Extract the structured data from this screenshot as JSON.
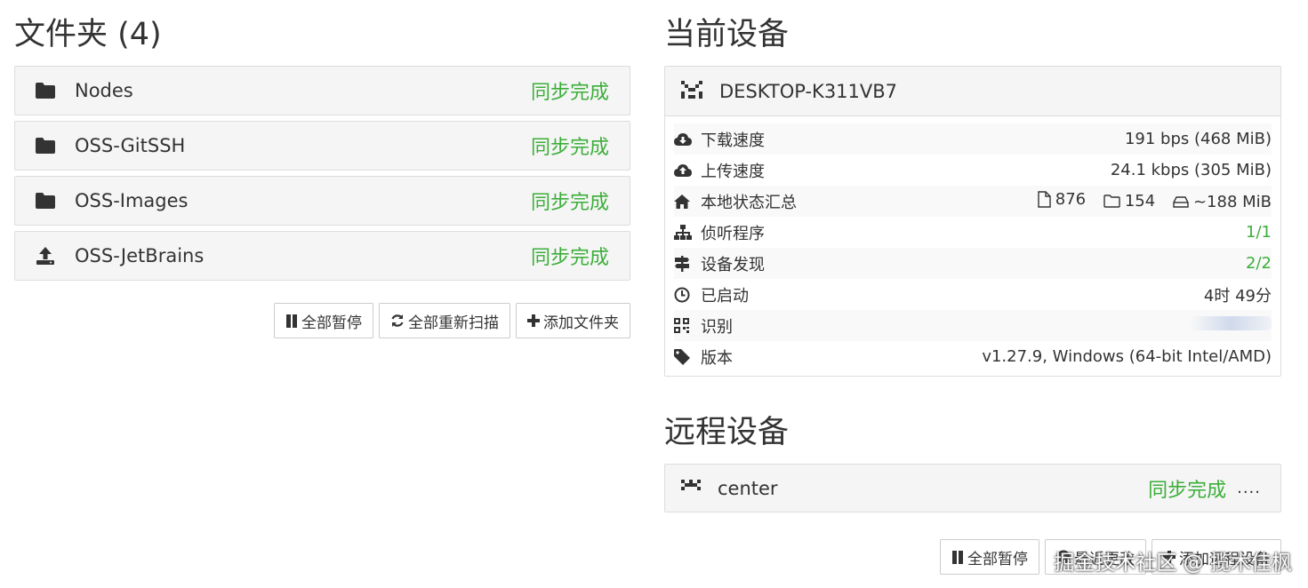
{
  "folders": {
    "title": "文件夹 (4)",
    "items": [
      {
        "name": "Nodes",
        "status": "同步完成",
        "icon": "folder-icon"
      },
      {
        "name": "OSS-GitSSH",
        "status": "同步完成",
        "icon": "folder-icon"
      },
      {
        "name": "OSS-Images",
        "status": "同步完成",
        "icon": "folder-icon"
      },
      {
        "name": "OSS-JetBrains",
        "status": "同步完成",
        "icon": "upload-icon"
      }
    ],
    "buttons": {
      "pause_all": "全部暂停",
      "rescan_all": "全部重新扫描",
      "add_folder": "添加文件夹"
    }
  },
  "this_device": {
    "title": "当前设备",
    "name": "DESKTOP-K311VB7",
    "rows": {
      "download_label": "下载速度",
      "download_value": "191 bps (468 MiB)",
      "upload_label": "上传速度",
      "upload_value": "24.1 kbps (305 MiB)",
      "local_state_label": "本地状态汇总",
      "local_files": "876",
      "local_dirs": "154",
      "local_size": "~188 MiB",
      "listeners_label": "侦听程序",
      "listeners_value": "1/1",
      "discovery_label": "设备发现",
      "discovery_value": "2/2",
      "uptime_label": "已启动",
      "uptime_value": "4时 49分",
      "id_label": "识别",
      "version_label": "版本",
      "version_value": "v1.27.9, Windows (64-bit Intel/AMD)"
    }
  },
  "remote_devices": {
    "title": "远程设备",
    "items": [
      {
        "name": "center",
        "status": "同步完成",
        "more": "...."
      }
    ],
    "buttons": {
      "pause_all": "全部暂停",
      "recent_changes": "最近更改",
      "add_remote": "添加远程设备"
    }
  },
  "watermark": "掘金技术社区 @ 揽木佳枫",
  "colors": {
    "status_green": "#3cae3a",
    "panel_bg": "#f5f5f5",
    "border": "#dddddd"
  }
}
